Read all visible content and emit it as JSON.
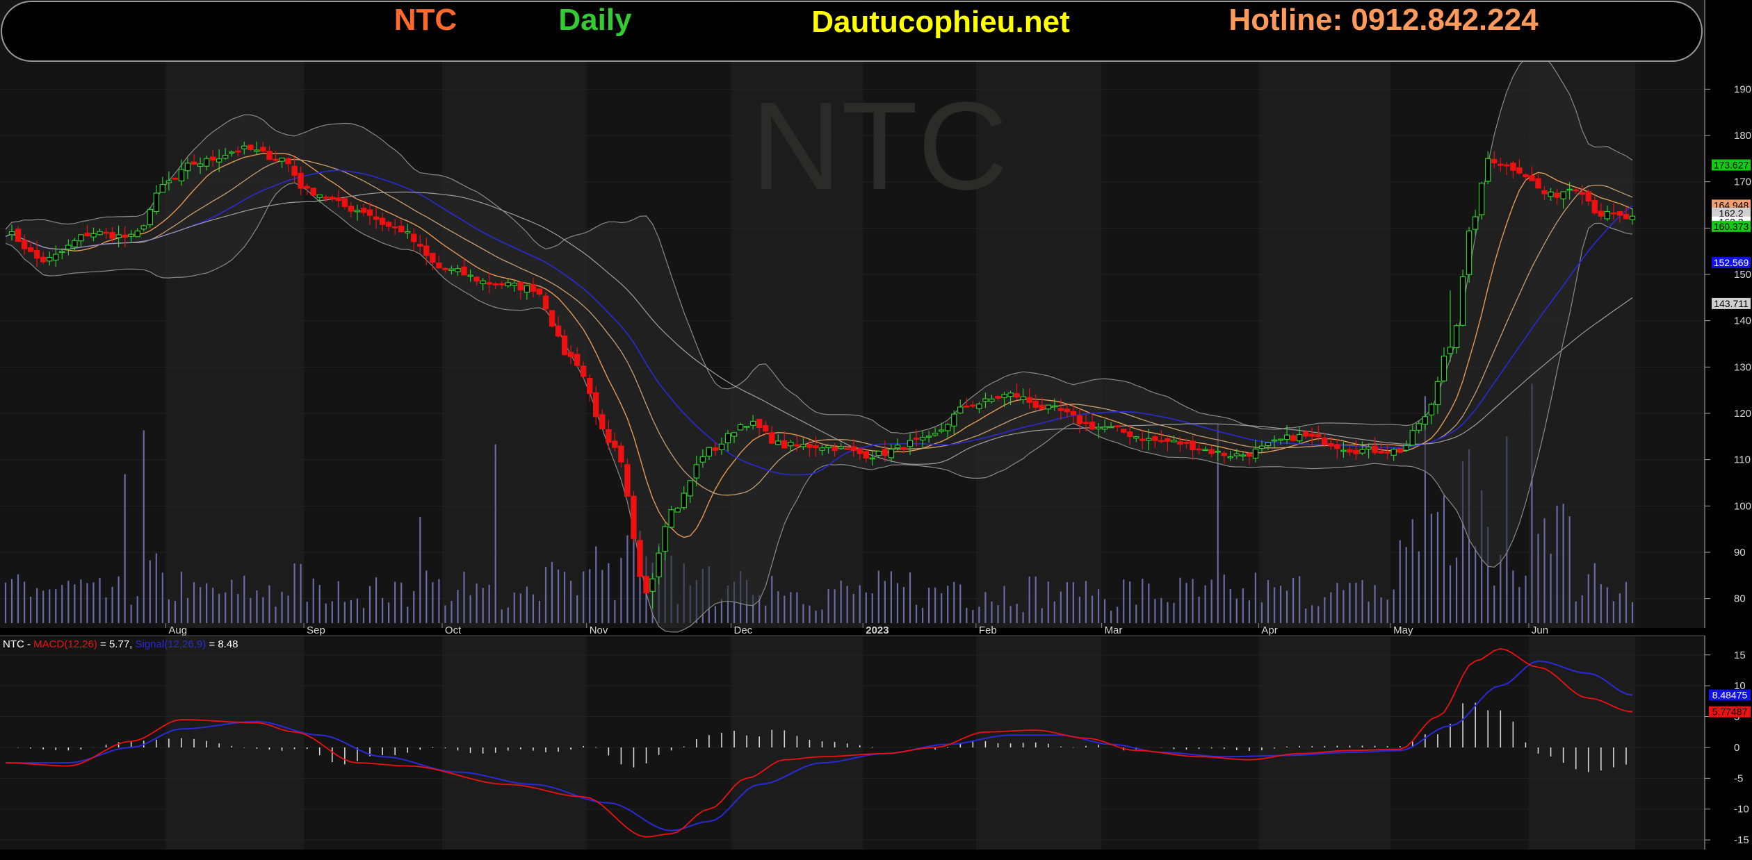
{
  "header": {
    "symbol": "NTC",
    "timeframe": "Daily",
    "site": "Dautucophieu.net",
    "hotline": "Hotline: 0912.842.224"
  },
  "watermark": "NTC",
  "colors": {
    "background": "#000000",
    "panel": "#111111",
    "band": "#1c1c1c",
    "up": "#2ecc2e",
    "down": "#ee1111",
    "volume": "#6a6aa6",
    "bollinger": "#8a8a8a",
    "ma_orange": "#e59a55",
    "ma_tan": "#c8a070",
    "ma_blue": "#2a2ad8",
    "ma_gray": "#a0a0a0",
    "macd": "#ee1111",
    "signal": "#2a2ad8",
    "symbol_text": "#ff6a2a",
    "timeframe_text": "#33cc33",
    "site_text": "#ffff00",
    "hotline_text": "#ff9a5a"
  },
  "chart_data": [
    {
      "type": "candlestick",
      "name": "NTC Daily",
      "ylim": [
        75,
        195
      ],
      "y_ticks": [
        80,
        90,
        100,
        110,
        120,
        130,
        140,
        150,
        160,
        170,
        180,
        190
      ],
      "x_months": [
        "Aug",
        "Sep",
        "Oct",
        "Nov",
        "Dec",
        "2023",
        "Feb",
        "Mar",
        "Apr",
        "May",
        "Jun"
      ],
      "x_month_index": [
        26,
        48,
        70,
        93,
        116,
        137,
        155,
        175,
        200,
        221,
        243
      ],
      "num_bars": 260,
      "anchors": [
        [
          0,
          159
        ],
        [
          6,
          153
        ],
        [
          14,
          159
        ],
        [
          20,
          158
        ],
        [
          26,
          170
        ],
        [
          30,
          174
        ],
        [
          38,
          177
        ],
        [
          44,
          175
        ],
        [
          48,
          168
        ],
        [
          56,
          164
        ],
        [
          62,
          160
        ],
        [
          70,
          151
        ],
        [
          78,
          148
        ],
        [
          84,
          147
        ],
        [
          90,
          132
        ],
        [
          97,
          112
        ],
        [
          102,
          82
        ],
        [
          106,
          99
        ],
        [
          112,
          112
        ],
        [
          118,
          118
        ],
        [
          124,
          113
        ],
        [
          130,
          113
        ],
        [
          138,
          111
        ],
        [
          146,
          114
        ],
        [
          154,
          122
        ],
        [
          160,
          124
        ],
        [
          166,
          121
        ],
        [
          174,
          117
        ],
        [
          184,
          114
        ],
        [
          196,
          111
        ],
        [
          206,
          115
        ],
        [
          216,
          112
        ],
        [
          222,
          112
        ],
        [
          226,
          119
        ],
        [
          230,
          135
        ],
        [
          234,
          163
        ],
        [
          236,
          175
        ],
        [
          240,
          173
        ],
        [
          246,
          167
        ],
        [
          250,
          169
        ],
        [
          254,
          163
        ],
        [
          259,
          162
        ]
      ],
      "macd_anchors": [
        [
          0,
          -2.5
        ],
        [
          10,
          -3
        ],
        [
          20,
          1
        ],
        [
          28,
          4.5
        ],
        [
          40,
          4
        ],
        [
          46,
          2.5
        ],
        [
          56,
          -2.5
        ],
        [
          64,
          -3
        ],
        [
          80,
          -6
        ],
        [
          92,
          -8
        ],
        [
          102,
          -14.5
        ],
        [
          106,
          -14
        ],
        [
          112,
          -10
        ],
        [
          118,
          -5
        ],
        [
          124,
          -2
        ],
        [
          130,
          -1.5
        ],
        [
          140,
          -1
        ],
        [
          148,
          0
        ],
        [
          156,
          2.5
        ],
        [
          164,
          2.8
        ],
        [
          172,
          1.5
        ],
        [
          180,
          -0.5
        ],
        [
          190,
          -1.5
        ],
        [
          198,
          -2
        ],
        [
          206,
          -1
        ],
        [
          214,
          -0.5
        ],
        [
          222,
          -0.3
        ],
        [
          228,
          5
        ],
        [
          234,
          14
        ],
        [
          238,
          16
        ],
        [
          244,
          13
        ],
        [
          252,
          8
        ],
        [
          259,
          5.77
        ]
      ],
      "signal_anchors": [
        [
          0,
          -2.5
        ],
        [
          10,
          -2.5
        ],
        [
          20,
          0
        ],
        [
          28,
          3
        ],
        [
          40,
          4.2
        ],
        [
          50,
          2
        ],
        [
          60,
          -1.5
        ],
        [
          72,
          -4
        ],
        [
          84,
          -6
        ],
        [
          96,
          -9
        ],
        [
          106,
          -13.5
        ],
        [
          112,
          -12
        ],
        [
          120,
          -6
        ],
        [
          130,
          -2.5
        ],
        [
          140,
          -1
        ],
        [
          150,
          0.5
        ],
        [
          160,
          2
        ],
        [
          168,
          2
        ],
        [
          176,
          0.5
        ],
        [
          184,
          -0.8
        ],
        [
          194,
          -1.5
        ],
        [
          204,
          -1.3
        ],
        [
          214,
          -0.8
        ],
        [
          222,
          -0.5
        ],
        [
          230,
          3.5
        ],
        [
          238,
          10
        ],
        [
          244,
          14
        ],
        [
          252,
          12
        ],
        [
          259,
          8.48
        ]
      ],
      "macd_ylim": [
        -16,
        17
      ],
      "macd_ticks": [
        15,
        10,
        5,
        0,
        -5,
        -10,
        -15
      ],
      "price_tags": [
        {
          "value": 173.627,
          "label": "173.627",
          "bg": "#11cc11",
          "fg": "#000000"
        },
        {
          "value": 164.948,
          "label": "164.948",
          "bg": "#f0a070",
          "fg": "#000000"
        },
        {
          "value": 163.2,
          "label": "162.2",
          "bg": "#d0d0d0",
          "fg": "#000000"
        },
        {
          "value": 161.3,
          "label": "162.2",
          "bg": "#ffffff",
          "fg": "#000000"
        },
        {
          "value": 160.373,
          "label": "160.373",
          "bg": "#11cc11",
          "fg": "#000000"
        },
        {
          "value": 152.569,
          "label": "152.569",
          "bg": "#1111ee",
          "fg": "#ffffff"
        },
        {
          "value": 143.711,
          "label": "143.711",
          "bg": "#d0d0d0",
          "fg": "#000000"
        }
      ],
      "macd_tags": [
        {
          "value": 8.48475,
          "label": "8.48475",
          "bg": "#1111ee",
          "fg": "#ffffff"
        },
        {
          "value": 5.77487,
          "label": "5.77487",
          "bg": "#ee1111",
          "fg": "#000000"
        }
      ]
    }
  ],
  "macd_legend": {
    "symbol": "NTC",
    "sep": " - ",
    "macd_label": "MACD(12,26)",
    "macd_value": " = 5.77, ",
    "signal_label": "Signal(12,26,9)",
    "signal_value": " = 8.48"
  }
}
